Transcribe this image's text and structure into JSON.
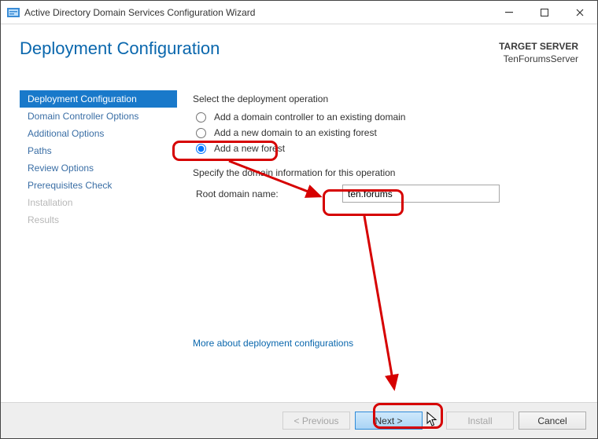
{
  "window": {
    "title": "Active Directory Domain Services Configuration Wizard"
  },
  "header": {
    "title": "Deployment Configuration",
    "target_label": "TARGET SERVER",
    "target_value": "TenForumsServer"
  },
  "sidebar": {
    "items": [
      {
        "label": "Deployment Configuration",
        "state": "selected"
      },
      {
        "label": "Domain Controller Options",
        "state": "normal"
      },
      {
        "label": "Additional Options",
        "state": "normal"
      },
      {
        "label": "Paths",
        "state": "normal"
      },
      {
        "label": "Review Options",
        "state": "normal"
      },
      {
        "label": "Prerequisites Check",
        "state": "normal"
      },
      {
        "label": "Installation",
        "state": "disabled"
      },
      {
        "label": "Results",
        "state": "disabled"
      }
    ]
  },
  "content": {
    "select_op_label": "Select the deployment operation",
    "radio_options": [
      {
        "label": "Add a domain controller to an existing domain",
        "checked": false
      },
      {
        "label": "Add a new domain to an existing forest",
        "checked": false
      },
      {
        "label": "Add a new forest",
        "checked": true
      }
    ],
    "specify_label": "Specify the domain information for this operation",
    "root_domain_label": "Root domain name:",
    "root_domain_value": "ten.forums",
    "more_link": "More about deployment configurations"
  },
  "footer": {
    "previous": "< Previous",
    "next": "Next >",
    "install": "Install",
    "cancel": "Cancel"
  },
  "colors": {
    "accent": "#1979ca",
    "link": "#0a67ad",
    "annotation": "#d60000"
  }
}
